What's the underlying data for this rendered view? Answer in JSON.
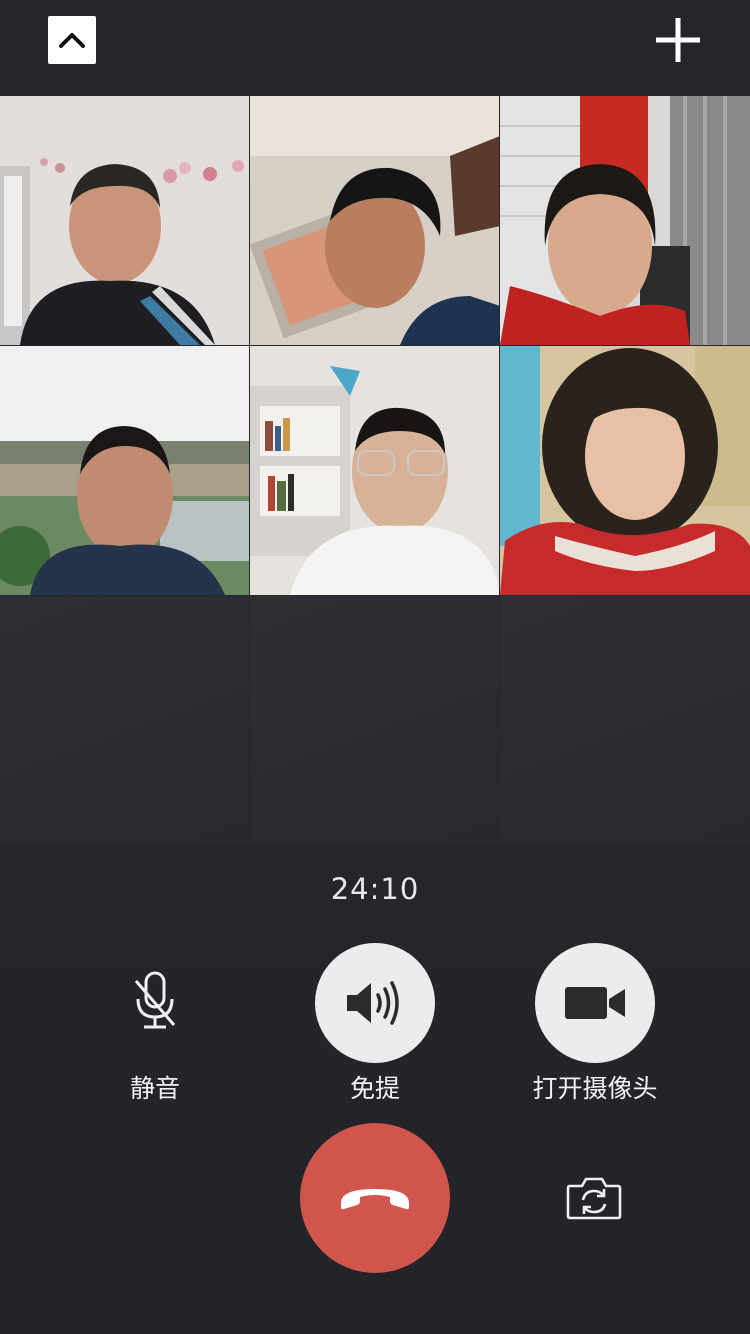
{
  "call": {
    "timer": "24:10"
  },
  "controls": {
    "mute_label": "静音",
    "speaker_label": "免提",
    "camera_label": "打开摄像头"
  },
  "icons": {
    "minimize": "chevron-up-icon",
    "add": "plus-icon",
    "mute": "microphone-off-icon",
    "speaker": "speaker-icon",
    "camera": "video-camera-icon",
    "hangup": "phone-hangup-icon",
    "switch_camera": "camera-switch-icon"
  },
  "participants": [
    {
      "slot": 1,
      "video": "on"
    },
    {
      "slot": 2,
      "video": "on"
    },
    {
      "slot": 3,
      "video": "on"
    },
    {
      "slot": 4,
      "video": "on"
    },
    {
      "slot": 5,
      "video": "on"
    },
    {
      "slot": 6,
      "video": "on"
    }
  ],
  "colors": {
    "hangup": "#d0554d",
    "button_fill": "#ececec",
    "background": "#24262b"
  }
}
